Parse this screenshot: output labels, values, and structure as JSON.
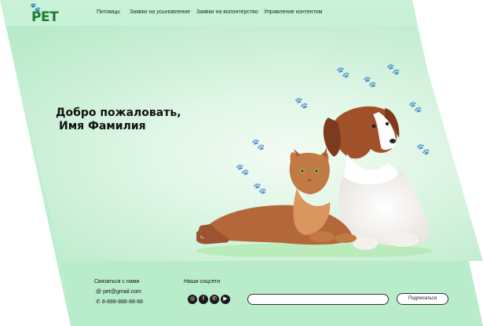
{
  "logo": {
    "text": "PET"
  },
  "nav": {
    "items": [
      "Питомцы",
      "Заявки на усыновление",
      "Заявки на волонтерство",
      "Управление контентом"
    ]
  },
  "hero": {
    "greeting_line1": "Добро пожаловать,",
    "greeting_line2": "Имя Фамилия"
  },
  "footer": {
    "contact_title": "Связаться с нами",
    "email": "pet@gmail.com",
    "phone": "8-888-888-88-88",
    "social_title": "Наши соцсети",
    "social_icons": [
      "instagram-icon",
      "facebook-icon",
      "whatsapp-icon",
      "youtube-icon"
    ],
    "email_input_placeholder": "",
    "subscribe_label": "Подписаться"
  },
  "colors": {
    "background": "#c9f2d8",
    "brand_green": "#1e7d2d",
    "text": "#111111"
  }
}
